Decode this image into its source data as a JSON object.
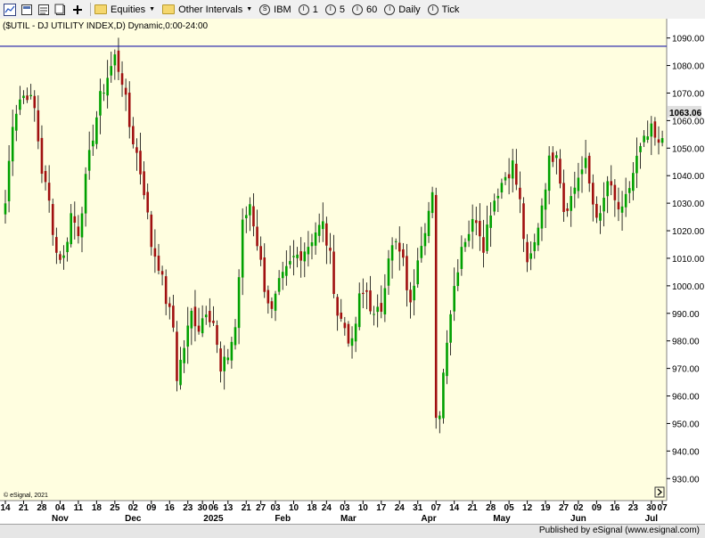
{
  "toolbar": {
    "equities_label": "Equities",
    "intervals_label": "Other Intervals",
    "symbol": "IBM",
    "interval_1": "1",
    "interval_5": "5",
    "interval_60": "60",
    "daily": "Daily",
    "tick": "Tick"
  },
  "footer": {
    "published": "Published by eSignal (www.esignal.com)"
  },
  "chart_data": {
    "type": "candlestick",
    "title": "($UTIL - DJ UTILITY INDEX,D) Dynamic,0:00-24:00",
    "watermark": "© eSignal, 2021",
    "last_price": "1063.06",
    "horizontal_line": 1087,
    "ylim": [
      922,
      1097
    ],
    "y_ticks": [
      "930.00",
      "940.00",
      "950.00",
      "960.00",
      "970.00",
      "980.00",
      "990.00",
      "1000.00",
      "1010.00",
      "1020.00",
      "1030.00",
      "1040.00",
      "1050.00",
      "1060.00",
      "1070.00",
      "1080.00",
      "1090.00"
    ],
    "day_ticks": [
      {
        "label": "14",
        "i": 0
      },
      {
        "label": "21",
        "i": 5
      },
      {
        "label": "28",
        "i": 10
      },
      {
        "label": "04",
        "i": 15
      },
      {
        "label": "11",
        "i": 20
      },
      {
        "label": "18",
        "i": 25
      },
      {
        "label": "25",
        "i": 30
      },
      {
        "label": "02",
        "i": 35
      },
      {
        "label": "09",
        "i": 40
      },
      {
        "label": "16",
        "i": 45
      },
      {
        "label": "23",
        "i": 50
      },
      {
        "label": "30",
        "i": 54
      },
      {
        "label": "06",
        "i": 57
      },
      {
        "label": "13",
        "i": 61
      },
      {
        "label": "21",
        "i": 66
      },
      {
        "label": "27",
        "i": 70
      },
      {
        "label": "03",
        "i": 74
      },
      {
        "label": "10",
        "i": 79
      },
      {
        "label": "18",
        "i": 84
      },
      {
        "label": "24",
        "i": 88
      },
      {
        "label": "03",
        "i": 93
      },
      {
        "label": "10",
        "i": 98
      },
      {
        "label": "17",
        "i": 103
      },
      {
        "label": "24",
        "i": 108
      },
      {
        "label": "31",
        "i": 113
      },
      {
        "label": "07",
        "i": 118
      },
      {
        "label": "14",
        "i": 123
      },
      {
        "label": "21",
        "i": 128
      },
      {
        "label": "28",
        "i": 133
      },
      {
        "label": "05",
        "i": 138
      },
      {
        "label": "12",
        "i": 143
      },
      {
        "label": "19",
        "i": 148
      },
      {
        "label": "27",
        "i": 153
      },
      {
        "label": "02",
        "i": 157
      },
      {
        "label": "09",
        "i": 162
      },
      {
        "label": "16",
        "i": 167
      },
      {
        "label": "23",
        "i": 172
      },
      {
        "label": "30",
        "i": 177
      },
      {
        "label": "07",
        "i": 180
      }
    ],
    "month_ticks": [
      {
        "label": "Nov",
        "i": 15
      },
      {
        "label": "Dec",
        "i": 35
      },
      {
        "label": "2025",
        "i": 57
      },
      {
        "label": "Feb",
        "i": 76
      },
      {
        "label": "Mar",
        "i": 94
      },
      {
        "label": "Apr",
        "i": 116
      },
      {
        "label": "May",
        "i": 136
      },
      {
        "label": "Jun",
        "i": 157
      },
      {
        "label": "Jul",
        "i": 177
      }
    ],
    "anchors": [
      [
        0,
        1030
      ],
      [
        2,
        1060
      ],
      [
        4,
        1068
      ],
      [
        6,
        1070
      ],
      [
        8,
        1064
      ],
      [
        10,
        1042
      ],
      [
        12,
        1030
      ],
      [
        14,
        1012
      ],
      [
        16,
        1010
      ],
      [
        18,
        1026
      ],
      [
        20,
        1020
      ],
      [
        22,
        1038
      ],
      [
        24,
        1055
      ],
      [
        26,
        1068
      ],
      [
        28,
        1076
      ],
      [
        30,
        1083
      ],
      [
        32,
        1075
      ],
      [
        34,
        1058
      ],
      [
        36,
        1048
      ],
      [
        38,
        1035
      ],
      [
        40,
        1015
      ],
      [
        42,
        1008
      ],
      [
        44,
        995
      ],
      [
        46,
        985
      ],
      [
        47,
        967
      ],
      [
        49,
        978
      ],
      [
        51,
        990
      ],
      [
        53,
        985
      ],
      [
        55,
        992
      ],
      [
        57,
        987
      ],
      [
        59,
        968
      ],
      [
        61,
        975
      ],
      [
        63,
        985
      ],
      [
        65,
        1022
      ],
      [
        67,
        1030
      ],
      [
        69,
        1016
      ],
      [
        71,
        1000
      ],
      [
        73,
        990
      ],
      [
        75,
        1000
      ],
      [
        77,
        1005
      ],
      [
        79,
        1010
      ],
      [
        81,
        1012
      ],
      [
        83,
        1015
      ],
      [
        85,
        1020
      ],
      [
        87,
        1022
      ],
      [
        89,
        1010
      ],
      [
        91,
        990
      ],
      [
        93,
        985
      ],
      [
        95,
        978
      ],
      [
        97,
        995
      ],
      [
        99,
        998
      ],
      [
        101,
        988
      ],
      [
        103,
        992
      ],
      [
        105,
        1012
      ],
      [
        107,
        1015
      ],
      [
        109,
        1008
      ],
      [
        111,
        992
      ],
      [
        113,
        1012
      ],
      [
        115,
        1022
      ],
      [
        117,
        1032
      ],
      [
        118,
        950
      ],
      [
        119,
        955
      ],
      [
        121,
        982
      ],
      [
        123,
        1000
      ],
      [
        125,
        1015
      ],
      [
        127,
        1020
      ],
      [
        129,
        1025
      ],
      [
        131,
        1015
      ],
      [
        133,
        1028
      ],
      [
        135,
        1035
      ],
      [
        137,
        1040
      ],
      [
        139,
        1044
      ],
      [
        141,
        1030
      ],
      [
        143,
        1006
      ],
      [
        145,
        1015
      ],
      [
        147,
        1030
      ],
      [
        149,
        1045
      ],
      [
        151,
        1050
      ],
      [
        153,
        1028
      ],
      [
        155,
        1032
      ],
      [
        157,
        1040
      ],
      [
        159,
        1044
      ],
      [
        161,
        1030
      ],
      [
        163,
        1024
      ],
      [
        165,
        1038
      ],
      [
        167,
        1030
      ],
      [
        169,
        1026
      ],
      [
        171,
        1036
      ],
      [
        173,
        1046
      ],
      [
        175,
        1052
      ],
      [
        177,
        1056
      ],
      [
        179,
        1050
      ],
      [
        181,
        1058
      ],
      [
        183,
        1063
      ]
    ]
  }
}
